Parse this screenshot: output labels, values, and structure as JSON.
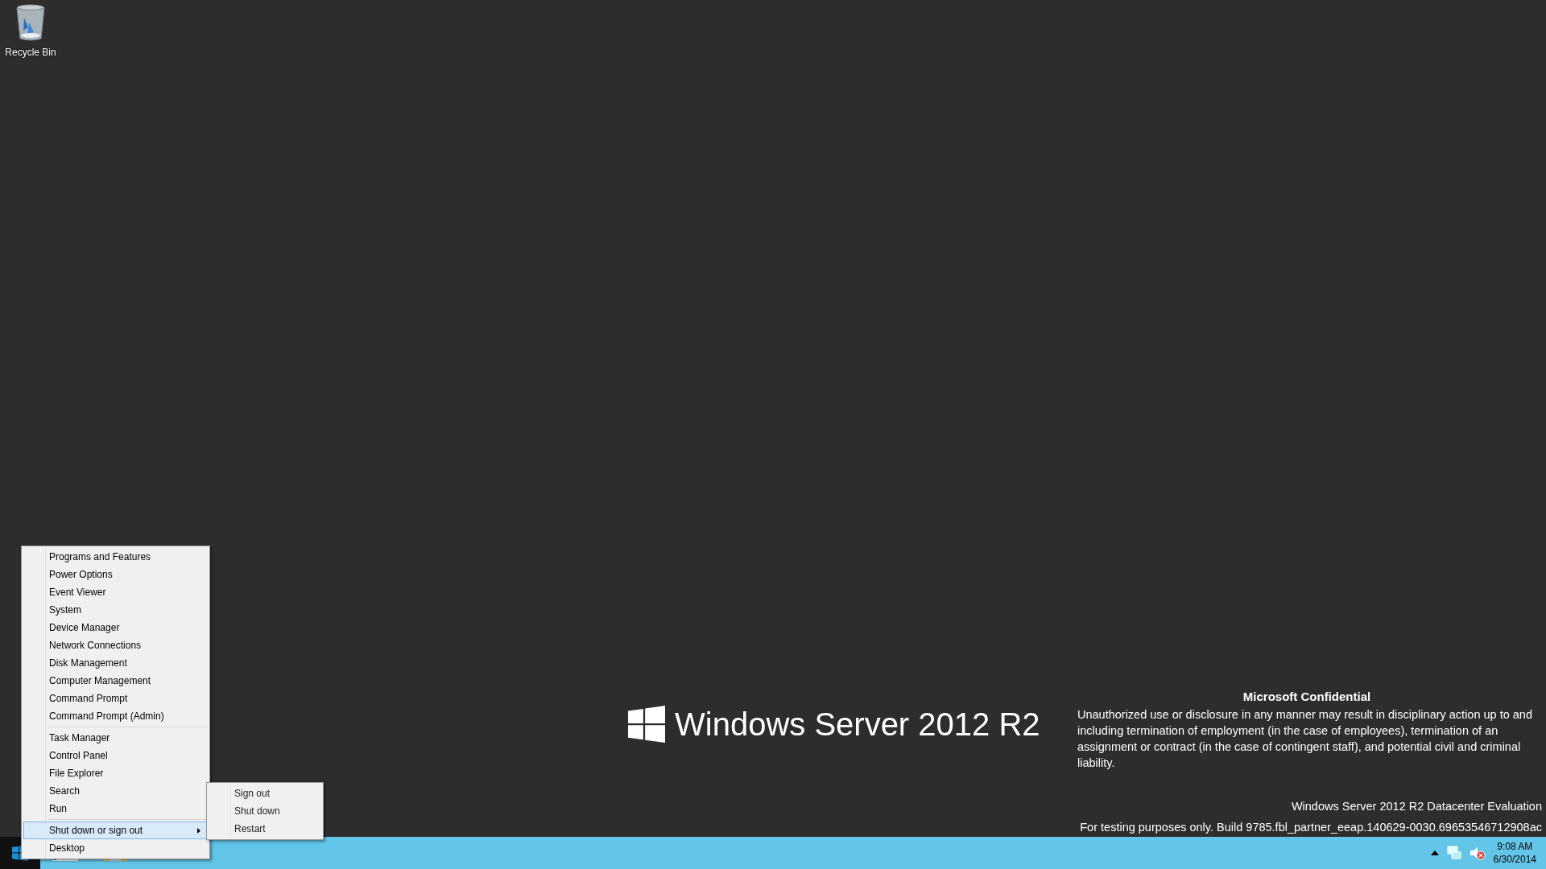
{
  "desktop_icons": [
    {
      "label": "Recycle Bin"
    }
  ],
  "context_menu": {
    "groups": [
      {
        "items": [
          {
            "label": "Programs and Features",
            "selected": false,
            "has_submenu": false
          },
          {
            "label": "Power Options",
            "selected": false,
            "has_submenu": false
          },
          {
            "label": "Event Viewer",
            "selected": false,
            "has_submenu": false
          },
          {
            "label": "System",
            "selected": false,
            "has_submenu": false
          },
          {
            "label": "Device Manager",
            "selected": false,
            "has_submenu": false
          },
          {
            "label": "Network Connections",
            "selected": false,
            "has_submenu": false
          },
          {
            "label": "Disk Management",
            "selected": false,
            "has_submenu": false
          },
          {
            "label": "Computer Management",
            "selected": false,
            "has_submenu": false
          },
          {
            "label": "Command Prompt",
            "selected": false,
            "has_submenu": false
          },
          {
            "label": "Command Prompt (Admin)",
            "selected": false,
            "has_submenu": false
          }
        ]
      },
      {
        "items": [
          {
            "label": "Task Manager",
            "selected": false,
            "has_submenu": false
          },
          {
            "label": "Control Panel",
            "selected": false,
            "has_submenu": false
          },
          {
            "label": "File Explorer",
            "selected": false,
            "has_submenu": false
          },
          {
            "label": "Search",
            "selected": false,
            "has_submenu": false
          },
          {
            "label": "Run",
            "selected": false,
            "has_submenu": false
          }
        ]
      },
      {
        "items": [
          {
            "label": "Shut down or sign out",
            "selected": true,
            "has_submenu": true
          },
          {
            "label": "Desktop",
            "selected": false,
            "has_submenu": false
          }
        ]
      }
    ],
    "submenu": {
      "items": [
        {
          "label": "Sign out",
          "selected": false
        },
        {
          "label": "Shut down",
          "selected": false
        },
        {
          "label": "Restart",
          "selected": false
        }
      ]
    }
  },
  "branding": {
    "product": "Windows Server 2012 R2"
  },
  "notice": {
    "title": "Microsoft Confidential",
    "text": "Unauthorized use or disclosure in any manner may result in disciplinary action up to and including termination of employment (in the case of employees), termination of an assignment or contract (in the case of contingent staff), and potential civil and criminal liability."
  },
  "build_info": {
    "edition": "Windows Server 2012 R2 Datacenter Evaluation",
    "build": "For testing purposes only. Build 9785.fbl_partner_eeap.140629-0030.69653546712908ac"
  },
  "taskbar": {
    "clock": {
      "time": "9:08 AM",
      "date": "6/30/2014"
    }
  }
}
